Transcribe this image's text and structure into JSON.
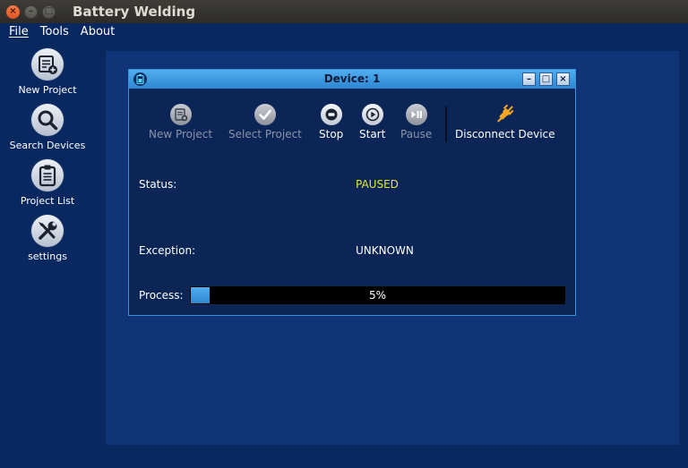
{
  "window": {
    "title": "Battery Welding",
    "close_glyph": "×",
    "minimize_glyph": "–",
    "maximize_glyph": "□"
  },
  "menu": {
    "items": [
      "File",
      "Tools",
      "About"
    ]
  },
  "sidebar": {
    "items": [
      {
        "label": "New Project",
        "icon": "new-project-icon"
      },
      {
        "label": "Search Devices",
        "icon": "search-icon"
      },
      {
        "label": "Project List",
        "icon": "clipboard-icon"
      },
      {
        "label": "settings",
        "icon": "tools-icon"
      }
    ]
  },
  "subwindow": {
    "title": "Device: 1",
    "minimize_glyph": "–",
    "maximize_glyph": "□",
    "close_glyph": "×"
  },
  "toolbar": {
    "items": [
      {
        "label": "New Project",
        "enabled": false,
        "icon": "new-project-icon"
      },
      {
        "label": "Select Project",
        "enabled": false,
        "icon": "check-icon"
      },
      {
        "label": "Stop",
        "enabled": true,
        "icon": "stop-icon"
      },
      {
        "label": "Start",
        "enabled": true,
        "icon": "play-icon"
      },
      {
        "label": "Pause",
        "enabled": false,
        "icon": "pause-icon"
      },
      {
        "label": "Disconnect Device",
        "enabled": true,
        "icon": "plug-disconnect-icon"
      }
    ]
  },
  "info": {
    "status_label": "Status:",
    "status_value": "PAUSED",
    "exception_label": "Exception:",
    "exception_value": "UNKNOWN",
    "process_label": "Process:"
  },
  "progress": {
    "percent": 5,
    "text": "5%"
  },
  "colors": {
    "background": "#0a2860",
    "mdi_area": "#0f3478",
    "subwindow_bg": "#0c2557",
    "accent": "#3a9ae8",
    "status_paused": "#e5e53a",
    "plug_icon": "#f5a623"
  }
}
